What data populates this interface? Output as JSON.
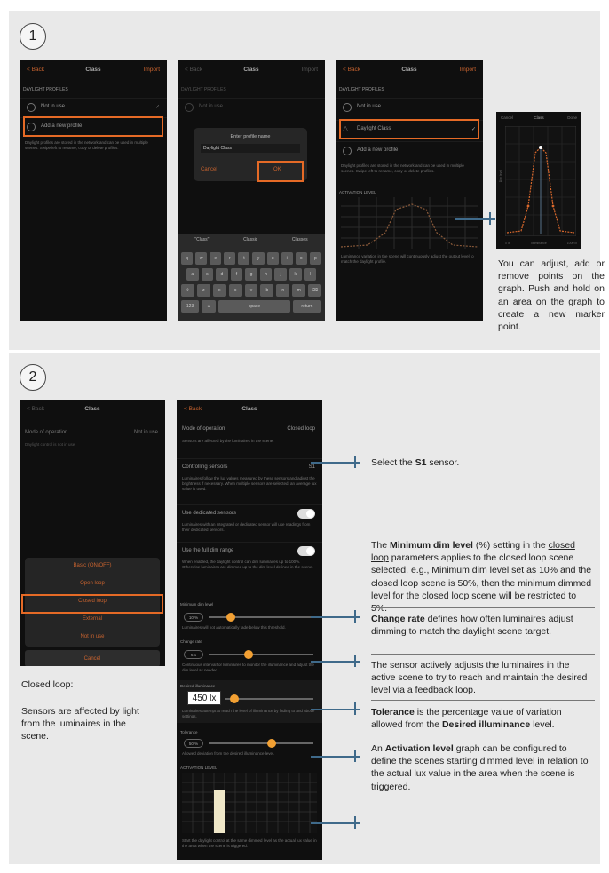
{
  "step1": {
    "number": "1",
    "phone1": {
      "back": "< Back",
      "title": "Class",
      "import": "Import",
      "section": "DAYLIGHT PROFILES",
      "row1": "Not in use",
      "row2": "Add a new profile",
      "footer": "Daylight profiles are stored in the network and can be used in multiple scenes. Swipe left to rename, copy or delete profiles."
    },
    "phone2": {
      "back": "< Back",
      "title": "Class",
      "import": "Import",
      "section": "DAYLIGHT PROFILES",
      "row1": "Not in use",
      "dialog_title": "Enter profile name",
      "dialog_value": "Daylight Class",
      "cancel": "Cancel",
      "ok": "OK",
      "suggestions": [
        "\"Class\"",
        "Classic",
        "Classes"
      ],
      "keys_row1": [
        "q",
        "w",
        "e",
        "r",
        "t",
        "y",
        "u",
        "i",
        "o",
        "p"
      ],
      "keys_row2": [
        "a",
        "s",
        "d",
        "f",
        "g",
        "h",
        "j",
        "k",
        "l"
      ],
      "keys_row3": [
        "⇧",
        "z",
        "x",
        "c",
        "v",
        "b",
        "n",
        "m",
        "⌫"
      ],
      "key_123": "123",
      "key_space": "space",
      "key_return": "return"
    },
    "phone3": {
      "back": "< Back",
      "title": "Class",
      "import": "Import",
      "section": "DAYLIGHT PROFILES",
      "row1": "Not in use",
      "row2": "Daylight Class",
      "row3": "Add a new profile",
      "footer": "Daylight profiles are stored in the network and can be used in multiple scenes. Swipe left to rename, copy or delete profiles.",
      "graph_label": "ACTIVATION LEVEL",
      "graph_footer": "Luminance variation in the scene will continuously adjust the output level to match the daylight profile."
    },
    "phone4": {
      "cancel": "Cancel",
      "title": "Class",
      "done": "Done",
      "y_label": "Dim level",
      "x_min": "0 lx",
      "x_mid": "Illuminance",
      "x_max": "1000 lx"
    },
    "note": "You can adjust, add or remove  points on the graph. Push and hold on an area on the graph to create a new marker point."
  },
  "step2": {
    "number": "2",
    "phoneA": {
      "back": "< Back",
      "title": "Class",
      "mode_label": "Mode of operation",
      "mode_value": "Not in use",
      "desc": "Daylight control is not in use",
      "options": [
        "Basic (ON/OFF)",
        "Open loop",
        "Closed loop",
        "External",
        "Not in use"
      ],
      "cancel": "Cancel"
    },
    "closed_loop_heading": "Closed loop:",
    "closed_loop_desc": "Sensors are affected by light from the luminaires in the scene.",
    "phoneB": {
      "back": "< Back",
      "title": "Class",
      "mode_label": "Mode of operation",
      "mode_value": "Closed loop",
      "mode_desc": "Sensors are affected by the luminaires in the scene.",
      "ctrl_label": "Controlling sensors",
      "ctrl_value": "S1",
      "ctrl_desc": "Luminaires follow the lux values measured by these sensors and adjust the brightness if necessary. When multiple sensors are selected, an average lux value is used.",
      "ded_label": "Use dedicated sensors",
      "ded_desc": "Luminaires with an integrated or dedicated sensor will use readings from their dedicated sensors.",
      "full_label": "Use the full dim range",
      "full_desc": "When enabled, the daylight control can dim luminaires up to 100%. Otherwise luminaires are dimmed up to the dim level defined in the scene.",
      "min_label": "Minimum dim level",
      "min_value": "10 %",
      "min_desc": "Luminaires will not automatically fade below this threshold.",
      "change_label": "Change rate",
      "change_value": "5 s",
      "change_desc": "Continuous interval for luminaires to monitor the illuminance and adjust the dim level as needed.",
      "des_label": "Desired illuminance",
      "des_value": "450 lx",
      "des_desc": "Luminaires attempt to reach the level of illuminance by fading to and above settings.",
      "tol_label": "Tolerance",
      "tol_value": "50 %",
      "tol_desc": "Allowed deviation from the desired illuminance level.",
      "act_label": "ACTIVATION LEVEL",
      "act_desc": "Start the daylight control at the same dimmed level as the actual lux value in the area when the scene is triggered."
    },
    "notes": {
      "select_pre": "Select the ",
      "select_bold": "S1",
      "select_post": " sensor.",
      "min_pre": "The ",
      "min_bold": "Minimum dim level",
      "min_mid": " (%) setting in the ",
      "min_u": "closed loop",
      "min_post": " parameters applies to the closed loop scene selected. e.g., Minimum dim level set as 10% and the closed loop scene is 50%, then the minimum dimmed level for the closed loop scene will be restricted to 5%.",
      "change_bold": "Change rate",
      "change_post": " defines how often luminaires adjust dimming to match the daylight scene target.",
      "sensor": "The sensor actively adjusts the luminaires in the active scene to try to reach and maintain the desired level via a feedback loop.",
      "tol_bold": "Tolerance",
      "tol_mid": " is the percentage value of variation allowed from the ",
      "tol_bold2": "Desired illuminance",
      "tol_post": " level.",
      "act_pre": "An ",
      "act_bold": "Activation level",
      "act_post": " graph can be configured to define the scenes starting dimmed level in relation to the actual lux value in the area when the scene is triggered."
    }
  },
  "colors": {
    "highlight": "#e56a26",
    "accent": "#f2a033",
    "connector": "#3f6a8a",
    "panel": "#e9e9e9",
    "phone_bg": "#0f0f0f"
  }
}
